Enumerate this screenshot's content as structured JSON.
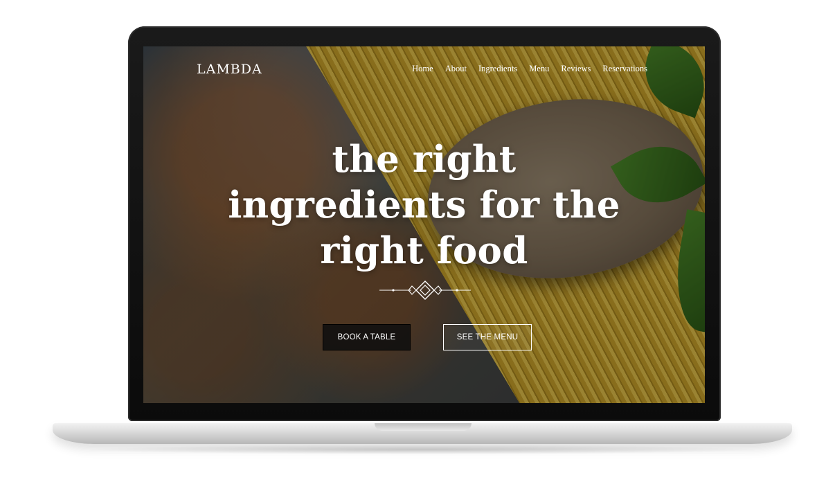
{
  "site": {
    "logo": "LAMBDA"
  },
  "nav": {
    "items": [
      {
        "label": "Home"
      },
      {
        "label": "About"
      },
      {
        "label": "Ingredients"
      },
      {
        "label": "Menu"
      },
      {
        "label": "Reviews"
      },
      {
        "label": "Reservations"
      }
    ]
  },
  "hero": {
    "title_line1": "the right",
    "title_line2": "ingredients for the",
    "title_line3": "right food",
    "book_button": "BOOK A TABLE",
    "menu_button": "SEE THE MENU"
  },
  "colors": {
    "text": "#ffffff",
    "book_button_bg": "#0f0f0f",
    "pasta_yellow": "#d2ad35",
    "laptop_bezel": "#0b0b0b"
  }
}
